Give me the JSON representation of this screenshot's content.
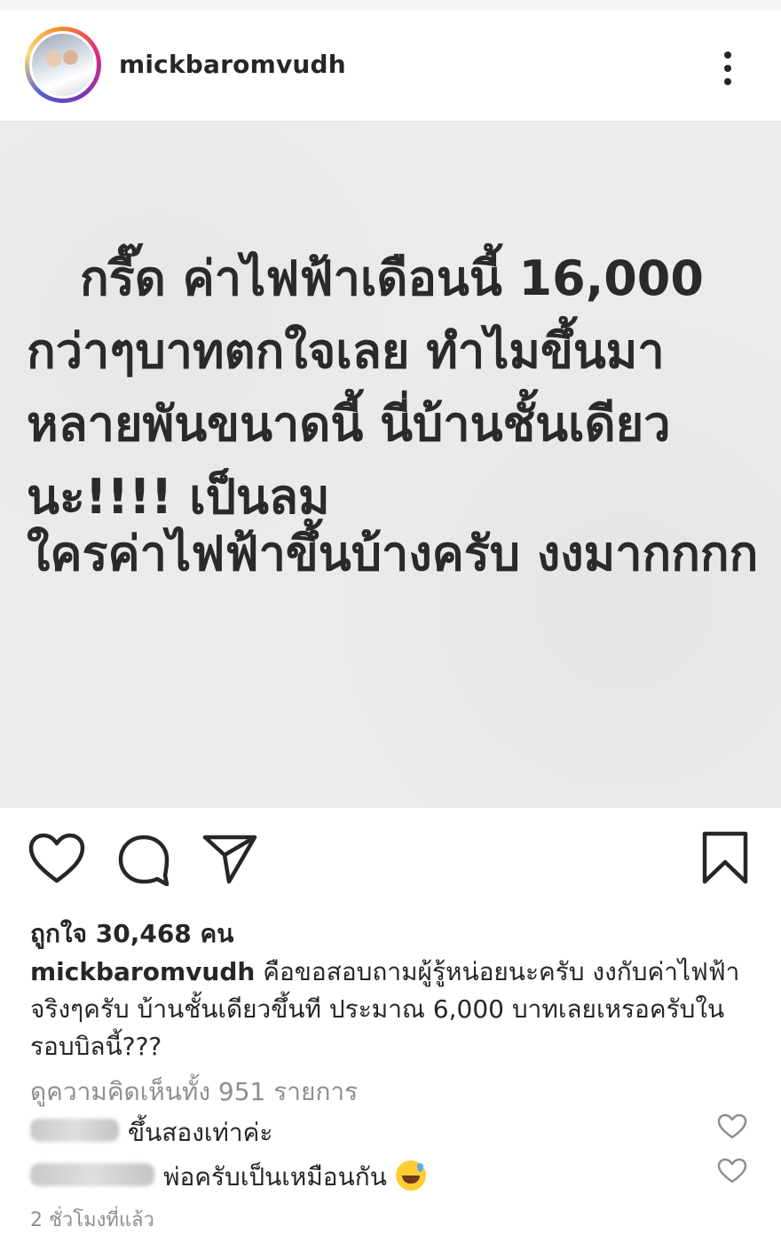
{
  "post": {
    "username": "mickbaromvudh",
    "image_lines": [
      "กรี๊ด ค่าไฟฟ้าเดือนนี้ 16,000",
      "กว่าๆบาทตกใจเลย  ทำไมขึ้นมา",
      "หลายพันขนาดนี้  นี่บ้านชั้นเดียว",
      "นะ!!!! เป็นลม",
      "ใครค่าไฟฟ้าขึ้นบ้างครับ งงมากกกก"
    ],
    "likes_text": "ถูกใจ 30,468 คน",
    "caption_user": "mickbaromvudh",
    "caption_text": "คือขอสอบถามผู้รู้หน่อยนะครับ งงกับค่าไฟฟ้าจริงๆครับ บ้านชั้นเดียวขึ้นที ประมาณ 6,000 บาทเลยเหรอครับในรอบบิลนี้???",
    "view_all_comments": "ดูความคิดเห็นทั้ง 951 รายการ",
    "comments": [
      {
        "text": "ขึ้นสองเท่าค่ะ"
      },
      {
        "text": "พ่อครับเป็นเหมือนกัน"
      }
    ],
    "timestamp": "2 ชั่วโมงที่แล้ว"
  },
  "icons": {
    "like": "heart-icon",
    "comment": "comment-bubble-icon",
    "share": "send-paper-plane-icon",
    "save": "bookmark-icon",
    "more": "more-vertical-icon"
  },
  "colors": {
    "text": "#262626",
    "muted": "#8e8e8e",
    "image_bg": "#ececec"
  }
}
